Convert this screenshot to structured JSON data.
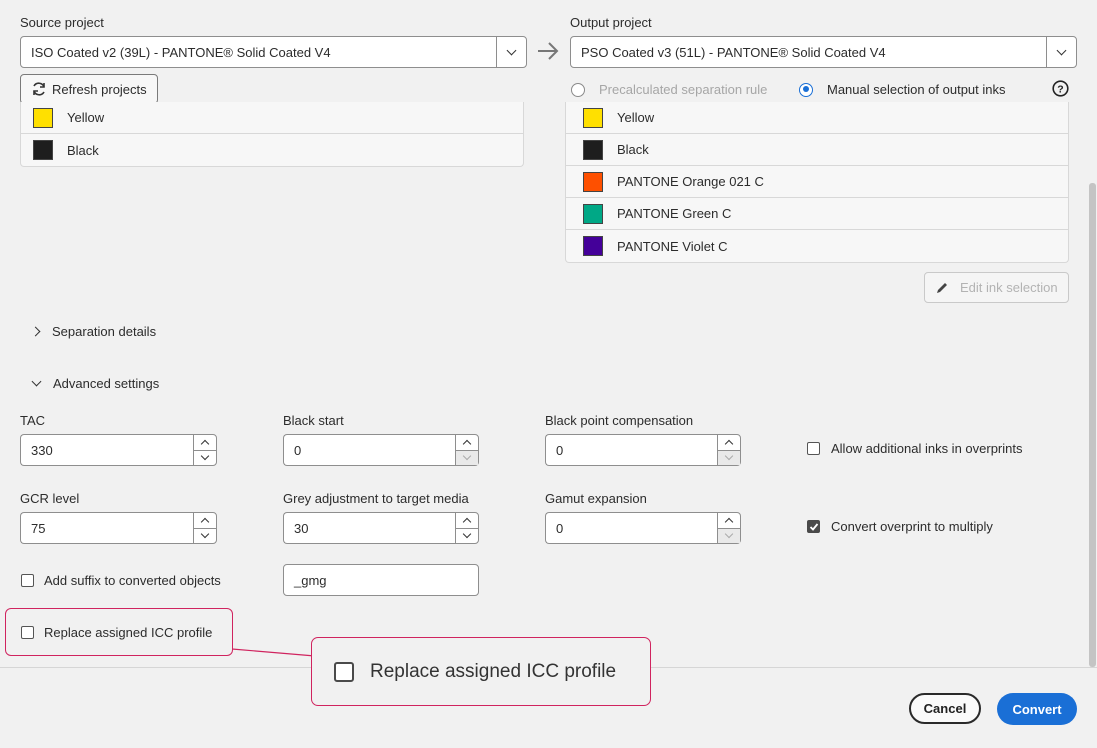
{
  "source": {
    "label": "Source project",
    "value": "ISO Coated v2 (39L) - PANTONE® Solid Coated V4",
    "refresh_label": "Refresh projects",
    "inks": [
      {
        "name": "Yellow",
        "color": "#ffe000"
      },
      {
        "name": "Black",
        "color": "#1e1e1e"
      }
    ]
  },
  "output": {
    "label": "Output project",
    "value": "PSO Coated v3 (51L) - PANTONE® Solid Coated V4",
    "radio_precalc": "Precalculated separation rule",
    "radio_manual": "Manual selection of output inks",
    "inks": [
      {
        "name": "Yellow",
        "color": "#ffe000"
      },
      {
        "name": "Black",
        "color": "#1e1e1e"
      },
      {
        "name": "PANTONE Orange 021 C",
        "color": "#fe5000"
      },
      {
        "name": "PANTONE Green C",
        "color": "#00a886"
      },
      {
        "name": "PANTONE Violet C",
        "color": "#440099"
      }
    ],
    "edit_label": "Edit ink selection"
  },
  "sections": {
    "separation": "Separation details",
    "advanced": "Advanced settings"
  },
  "fields": {
    "tac": {
      "label": "TAC",
      "value": "330"
    },
    "black_start": {
      "label": "Black start",
      "value": "0"
    },
    "bpc": {
      "label": "Black point compensation",
      "value": "0"
    },
    "gcr": {
      "label": "GCR level",
      "value": "75"
    },
    "grey": {
      "label": "Grey adjustment to target media",
      "value": "30"
    },
    "gamut": {
      "label": "Gamut expansion",
      "value": "0"
    },
    "suffix_value": "_gmg"
  },
  "checks": {
    "allow_inks": "Allow additional inks in overprints",
    "overprint": "Convert overprint to multiply",
    "suffix": "Add suffix to converted objects",
    "replace_icc": "Replace assigned ICC profile"
  },
  "callout": {
    "text": "Replace assigned ICC profile"
  },
  "footer": {
    "cancel": "Cancel",
    "convert": "Convert"
  },
  "colors": {
    "accent": "#1a6fd6",
    "highlight": "#d0245f"
  }
}
